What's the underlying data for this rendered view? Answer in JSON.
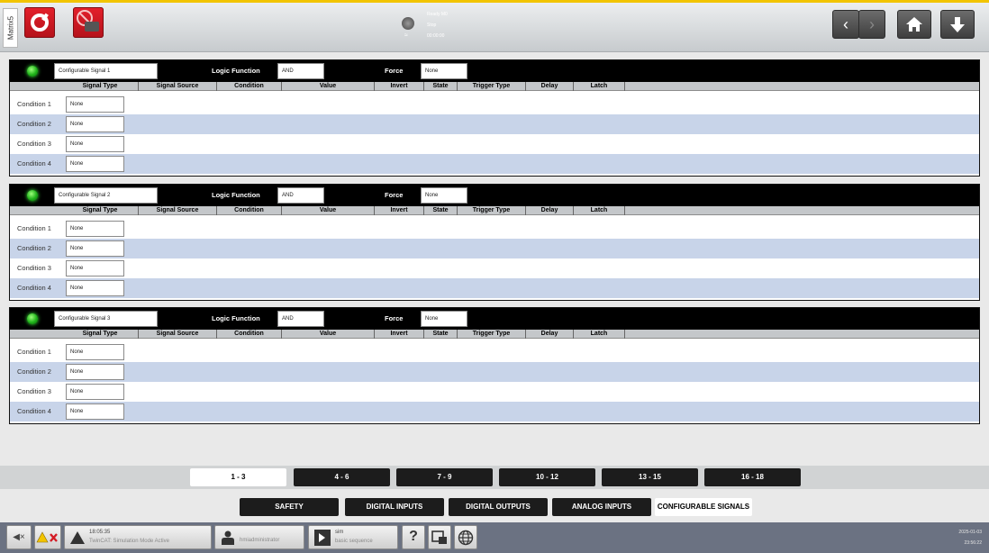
{
  "header": {
    "side_tab": "Matrix5",
    "status": {
      "line1": "Ready M0",
      "line2": "Stop",
      "line3": "00:00:00"
    },
    "nav": {
      "back_symbol": "‹",
      "fwd_symbol": "›"
    }
  },
  "panels": [
    {
      "name": "Configurable Signal 1",
      "logic_label": "Logic Function",
      "logic_value": "AND",
      "force_label": "Force",
      "force_value": "None",
      "columns": [
        "Signal Type",
        "Signal Source",
        "Condition",
        "Value",
        "Invert",
        "State",
        "Trigger Type",
        "Delay",
        "Latch"
      ],
      "rows": [
        {
          "label": "Condition 1",
          "value": "None"
        },
        {
          "label": "Condition 2",
          "value": "None"
        },
        {
          "label": "Condition 3",
          "value": "None"
        },
        {
          "label": "Condition 4",
          "value": "None"
        }
      ]
    },
    {
      "name": "Configurable Signal 2",
      "logic_label": "Logic Function",
      "logic_value": "AND",
      "force_label": "Force",
      "force_value": "None",
      "columns": [
        "Signal Type",
        "Signal Source",
        "Condition",
        "Value",
        "Invert",
        "State",
        "Trigger Type",
        "Delay",
        "Latch"
      ],
      "rows": [
        {
          "label": "Condition 1",
          "value": "None"
        },
        {
          "label": "Condition 2",
          "value": "None"
        },
        {
          "label": "Condition 3",
          "value": "None"
        },
        {
          "label": "Condition 4",
          "value": "None"
        }
      ]
    },
    {
      "name": "Configurable Signal 3",
      "logic_label": "Logic Function",
      "logic_value": "AND",
      "force_label": "Force",
      "force_value": "None",
      "columns": [
        "Signal Type",
        "Signal Source",
        "Condition",
        "Value",
        "Invert",
        "State",
        "Trigger Type",
        "Delay",
        "Latch"
      ],
      "rows": [
        {
          "label": "Condition 1",
          "value": "None"
        },
        {
          "label": "Condition 2",
          "value": "None"
        },
        {
          "label": "Condition 3",
          "value": "None"
        },
        {
          "label": "Condition 4",
          "value": "None"
        }
      ]
    }
  ],
  "page_tabs": [
    "1 - 3",
    "4 - 6",
    "7 - 9",
    "10 - 12",
    "13 - 15",
    "16 - 18"
  ],
  "category_tabs": [
    "SAFETY",
    "DIGITAL INPUTS",
    "DIGITAL OUTPUTS",
    "ANALOG INPUTS",
    "CONFIGURABLE SIGNALS"
  ],
  "footer": {
    "mute_symbol": "◀×",
    "message_time": "18:05:35",
    "message_text": "TwinCAT: Simulation Mode Active",
    "user": "hmiadministrator",
    "recipe_name": "sim",
    "recipe_desc": "basic sequence",
    "help_symbol": "?",
    "date": "2025-01-03",
    "time": "23:56:22"
  },
  "colors": {
    "accent": "#f2c400",
    "red": "#d41b25",
    "led": "#2ecc2e",
    "row_alt": "#c8d4e9"
  }
}
